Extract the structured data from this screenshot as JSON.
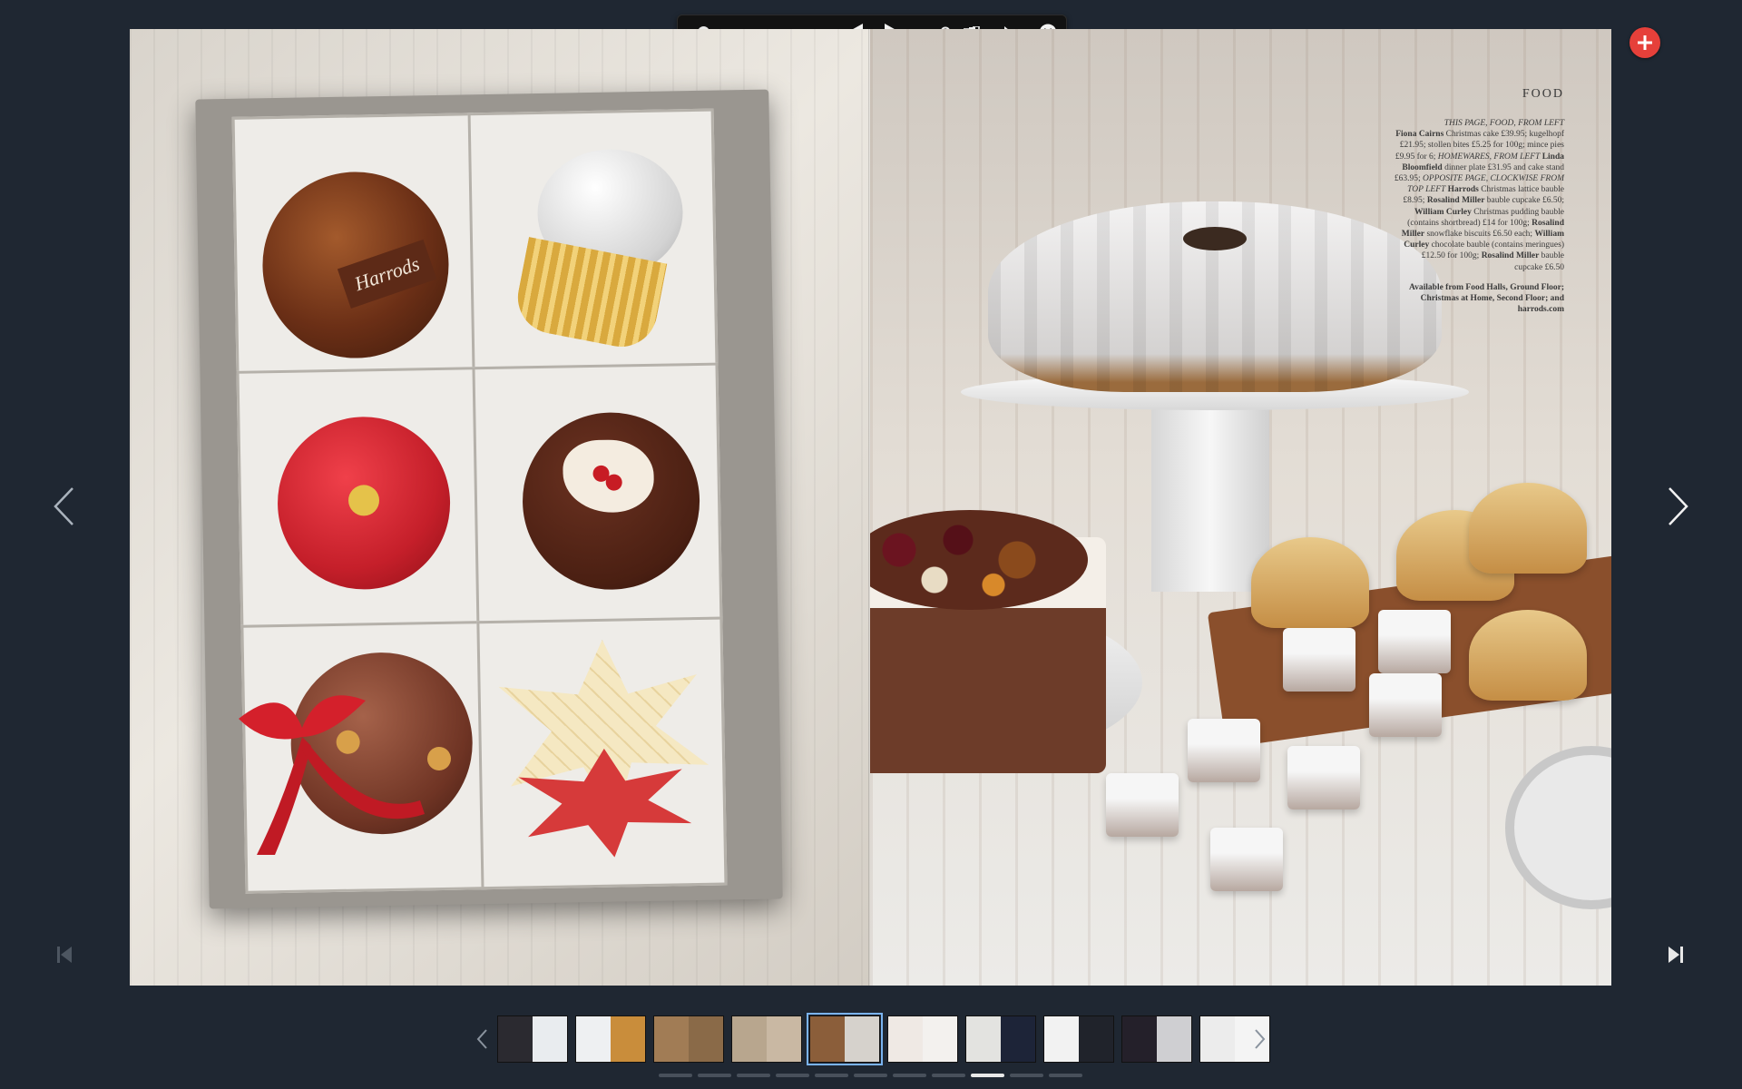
{
  "toolbar": {
    "items": [
      "zoom-slider",
      "two-page-view",
      "previous-page",
      "play",
      "search",
      "pages-view",
      "share",
      "close"
    ]
  },
  "article": {
    "section": "FOOD",
    "credits_html_parts": [
      {
        "t": "THIS PAGE, FOOD, FROM LEFT",
        "style": "i"
      },
      {
        "t": "Fiona Cairns",
        "style": "b"
      },
      {
        "t": " Christmas cake £39.95; kugelhopf £21.95; stollen bites £5.25 for 100g; mince pies £9.95 for 6; ",
        "style": ""
      },
      {
        "t": "HOMEWARES, FROM LEFT",
        "style": "i"
      },
      {
        "t": " Linda Bloomfield",
        "style": "b"
      },
      {
        "t": " dinner plate £31.95 and cake stand £63.95; ",
        "style": ""
      },
      {
        "t": "OPPOSITE PAGE, CLOCKWISE FROM TOP LEFT",
        "style": "i"
      },
      {
        "t": " Harrods",
        "style": "b"
      },
      {
        "t": " Christmas lattice bauble £8.95; ",
        "style": ""
      },
      {
        "t": "Rosalind Miller",
        "style": "b"
      },
      {
        "t": " bauble cupcake £6.50; ",
        "style": ""
      },
      {
        "t": "William Curley",
        "style": "b"
      },
      {
        "t": " Christmas pudding bauble (contains shortbread) £14 for 100g; ",
        "style": ""
      },
      {
        "t": "Rosalind Miller",
        "style": "b"
      },
      {
        "t": " snowflake biscuits £6.50 each; ",
        "style": ""
      },
      {
        "t": "William Curley",
        "style": "b"
      },
      {
        "t": " chocolate bauble (contains meringues) £12.50 for 100g; ",
        "style": ""
      },
      {
        "t": "Rosalind Miller",
        "style": "b"
      },
      {
        "t": " bauble cupcake £6.50",
        "style": ""
      }
    ],
    "availability": "Available from Food Halls, Ground Floor; Christmas at Home, Second Floor; and harrods.com"
  },
  "harrods_bauble_text": "Harrods",
  "thumbnails": [
    {
      "left": "#2b2a30",
      "right": "#e9ecef"
    },
    {
      "left": "#eef0f2",
      "right": "#c98d3b"
    },
    {
      "left": "#a17c55",
      "right": "#8a6a48"
    },
    {
      "left": "#b8a68e",
      "right": "#c9b8a3"
    },
    {
      "left": "#8b5e3a",
      "right": "#d6d2cc",
      "active": true
    },
    {
      "left": "#efe9e4",
      "right": "#f3f1ee"
    },
    {
      "left": "#e3e3e0",
      "right": "#1d2438"
    },
    {
      "left": "#f2f2f2",
      "right": "#20232b"
    },
    {
      "left": "#24202a",
      "right": "#cfcfd2"
    },
    {
      "left": "#ececec",
      "right": "#f4f4f4"
    }
  ],
  "pager_dots": 11,
  "pager_active_index": 8,
  "colors": {
    "background": "#1f2732",
    "plus_button": "#e6403a",
    "active_thumb_outline": "#7ab3f0"
  }
}
